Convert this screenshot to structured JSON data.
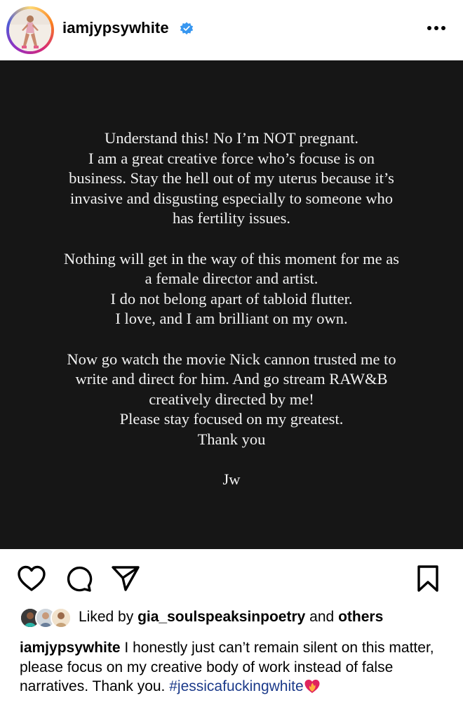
{
  "header": {
    "username": "iamjypsywhite",
    "verified": true,
    "icons": {
      "avatar": "profile-photo",
      "verified": "verified-badge-icon",
      "more": "more-options-icon"
    }
  },
  "post": {
    "background": "#161616",
    "text_color": "#f2f2f2",
    "lines": [
      "Understand this! No I’m NOT pregnant.",
      "I am a great creative force who’s focuse is on",
      "business. Stay the hell out of my uterus because it’s",
      "invasive and disgusting especially to someone who",
      "has fertility issues.",
      "",
      "Nothing will get in the way of this moment for me as",
      "a female director and artist.",
      "I do not belong apart of tabloid flutter.",
      "I love, and I am brilliant on my own.",
      "",
      "Now go watch the movie Nick cannon trusted me to",
      "write and direct for him. And go stream RAW&B",
      "creatively directed by me!",
      "Please stay focused on my greatest.",
      "Thank you",
      "",
      "Jw"
    ]
  },
  "actions": {
    "icons": [
      "heart-icon",
      "comment-icon",
      "share-icon",
      "bookmark-icon"
    ]
  },
  "likes": {
    "prefix": "Liked by",
    "user": "gia_soulspeaksinpoetry",
    "connector": "and",
    "others": "others"
  },
  "caption": {
    "username": "iamjypsywhite",
    "text": "I honestly just can’t remain silent on this matter, please focus on my creative body of work instead of false narratives. Thank you.",
    "hashtag": "#jessicafuckingwhite",
    "emoji": "heart-on-fire-emoji"
  },
  "colors": {
    "hashtag": "#1b3a8a",
    "verified": "#3897f0"
  }
}
